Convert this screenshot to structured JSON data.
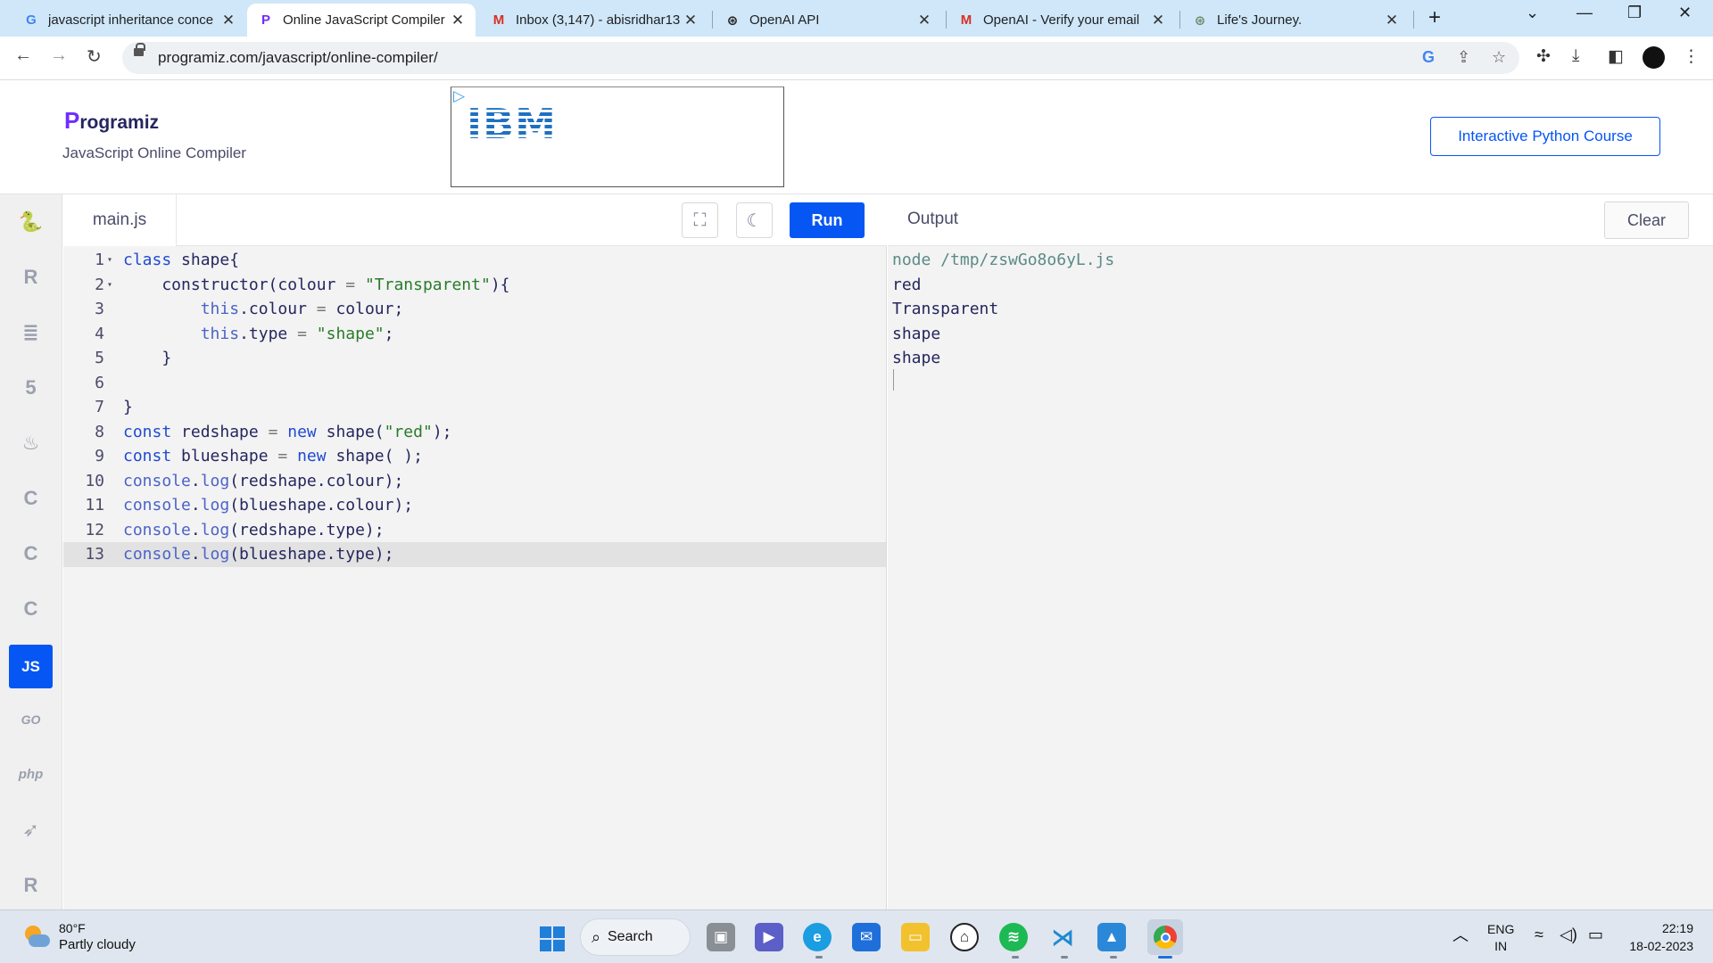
{
  "browser": {
    "tabs": [
      {
        "title": "javascript inheritance conce",
        "icon": "google-icon",
        "active": false
      },
      {
        "title": "Online JavaScript Compiler",
        "icon": "programiz-icon",
        "active": true
      },
      {
        "title": "Inbox (3,147) - abisridhar13",
        "icon": "gmail-icon",
        "active": false
      },
      {
        "title": "OpenAI API",
        "icon": "openai-icon",
        "active": false
      },
      {
        "title": "OpenAI - Verify your email",
        "icon": "gmail-icon",
        "active": false
      },
      {
        "title": "Life's Journey.",
        "icon": "chatgpt-icon",
        "active": false
      }
    ],
    "url": "programiz.com/javascript/online-compiler/"
  },
  "site": {
    "logo_text": "rogramiz",
    "logo_letter": "P",
    "subtitle": "JavaScript Online Compiler",
    "ad_text": "IBM",
    "course_button": "Interactive Python Course"
  },
  "sidebar": {
    "items": [
      {
        "name": "python",
        "label": "🐍",
        "active": false
      },
      {
        "name": "r",
        "label": "R",
        "active": false
      },
      {
        "name": "sql",
        "label": "≣",
        "active": false
      },
      {
        "name": "html",
        "label": "5",
        "active": false
      },
      {
        "name": "java",
        "label": "♨",
        "active": false
      },
      {
        "name": "c",
        "label": "C",
        "active": false
      },
      {
        "name": "cpp",
        "label": "C",
        "active": false
      },
      {
        "name": "csharp",
        "label": "C",
        "active": false
      },
      {
        "name": "javascript",
        "label": "JS",
        "active": true
      },
      {
        "name": "go",
        "label": "GO",
        "active": false
      },
      {
        "name": "php",
        "label": "php",
        "active": false
      },
      {
        "name": "swift",
        "label": "➶",
        "active": false
      },
      {
        "name": "rust",
        "label": "R",
        "active": false
      }
    ]
  },
  "editor": {
    "filename": "main.js",
    "run_label": "Run",
    "code_lines": [
      "class shape{",
      "    constructor(colour = \"Transparent\"){",
      "        this.colour = colour;",
      "        this.type = \"shape\";",
      "    }",
      "    ",
      "}",
      "const redshape = new shape(\"red\");",
      "const blueshape = new shape( );",
      "console.log(redshape.colour);",
      "console.log(blueshape.colour);",
      "console.log(redshape.type);",
      "console.log(blueshape.type);"
    ]
  },
  "output": {
    "title": "Output",
    "clear_label": "Clear",
    "command": "node /tmp/zswGo8o6yL.js",
    "lines": [
      "red",
      "Transparent",
      "shape",
      "shape"
    ]
  },
  "taskbar": {
    "temperature": "80°F",
    "weather": "Partly cloudy",
    "search_label": "Search",
    "language": "ENG",
    "region": "IN",
    "time": "22:19",
    "date": "18-02-2023"
  }
}
